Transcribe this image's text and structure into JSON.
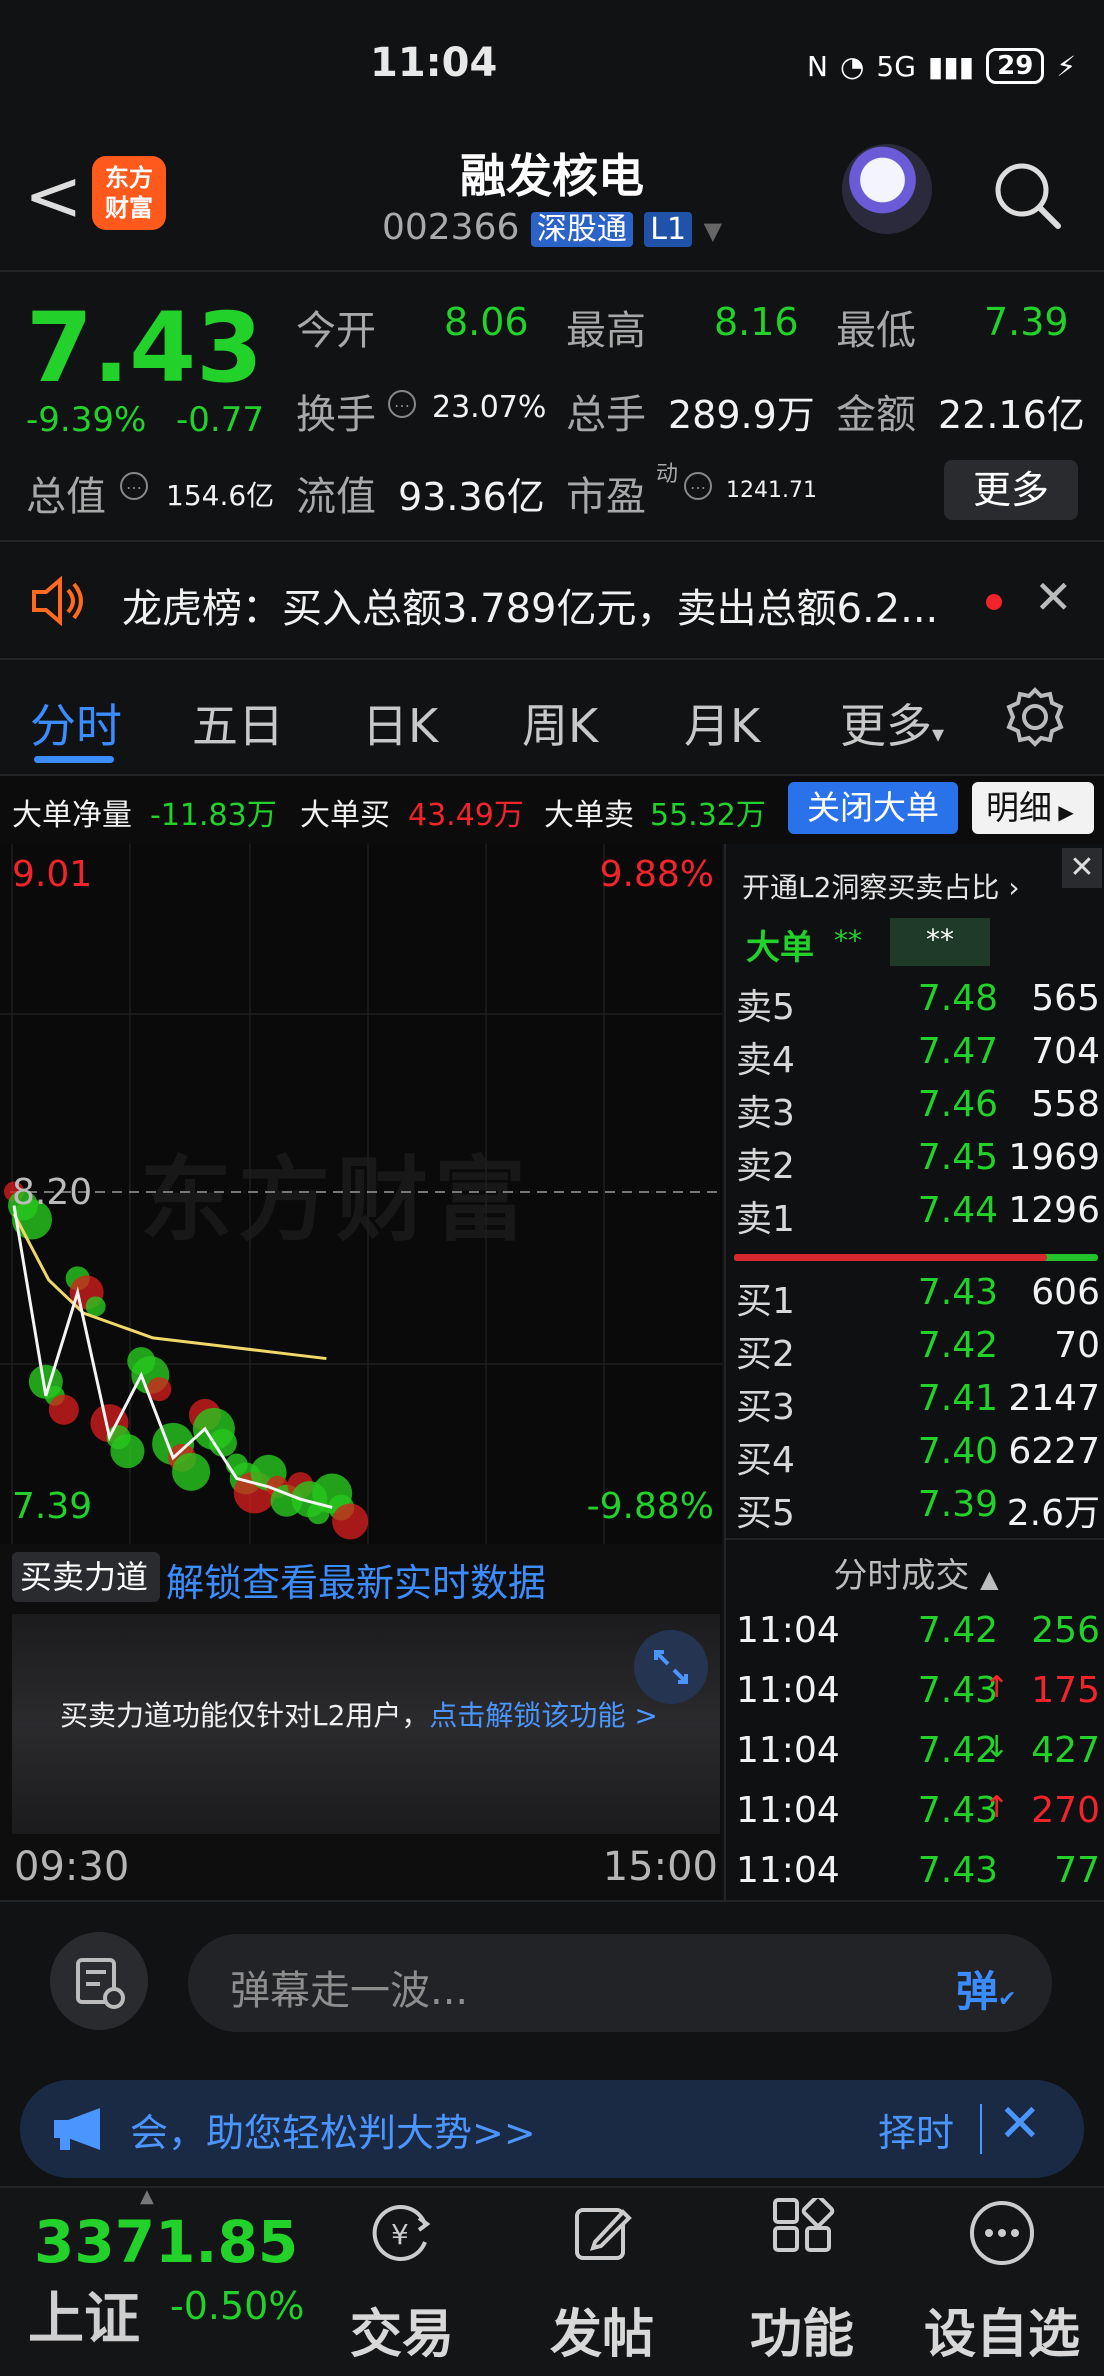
{
  "status": {
    "time": "11:04",
    "network": "5G",
    "battery": "29"
  },
  "header": {
    "back_label": "<",
    "logo_text_1": "东方",
    "logo_text_2": "财富",
    "stock_name": "融发核电",
    "stock_code": "002366",
    "tag_connect": "深股通",
    "tag_level": "L1"
  },
  "quote": {
    "price": "7.43",
    "pct_change": "-9.39%",
    "change": "-0.77",
    "open_label": "今开",
    "open": "8.06",
    "high_label": "最高",
    "high": "8.16",
    "low_label": "最低",
    "low": "7.39",
    "turnover_label": "换手",
    "turnover": "23.07%",
    "volume_label": "总手",
    "volume": "289.9万",
    "amount_label": "金额",
    "amount": "22.16亿",
    "mktcap_label": "总值",
    "mktcap": "154.6亿",
    "float_label": "流值",
    "float_cap": "93.36亿",
    "pe_label": "市盈",
    "pe_sup": "动",
    "pe": "1241.71",
    "more_label": "更多"
  },
  "news": {
    "text": "龙虎榜：买入总额3.789亿元，卖出总额6.2..."
  },
  "tabs": [
    "分时",
    "五日",
    "日K",
    "周K",
    "月K",
    "更多"
  ],
  "big_order": {
    "net_label": "大单净量",
    "net": "-11.83万",
    "buy_label": "大单买",
    "buy": "43.49万",
    "sell_label": "大单卖",
    "sell": "55.32万",
    "close_label": "关闭大单",
    "detail_label": "明细"
  },
  "chart": {
    "top_left": "9.01",
    "top_right": "9.88%",
    "mid_left": "8.20",
    "bottom_left": "7.39",
    "bottom_right": "-9.88%",
    "watermark": "东方财富"
  },
  "chart_data": {
    "type": "line",
    "title": "",
    "xlabel": "",
    "ylabel": "",
    "x_range": [
      "09:30",
      "15:00"
    ],
    "ylim": [
      7.39,
      9.01
    ],
    "reference_price": 8.2,
    "series": [
      {
        "name": "",
        "values": [
          8.14,
          7.98,
          7.9,
          7.87,
          7.84,
          7.83,
          7.82,
          7.81,
          7.8,
          7.79
        ]
      },
      {
        "name": "",
        "values": [
          8.16,
          7.7,
          7.95,
          7.6,
          7.75,
          7.55,
          7.62,
          7.5,
          7.48,
          7.45,
          7.43
        ]
      }
    ]
  },
  "book": {
    "promo": "开通L2洞察买卖占比",
    "big_label": "大单",
    "big_val1": "**",
    "big_val2": "**",
    "sells": [
      {
        "name": "卖5",
        "price": "7.48",
        "vol": "565"
      },
      {
        "name": "卖4",
        "price": "7.47",
        "vol": "704"
      },
      {
        "name": "卖3",
        "price": "7.46",
        "vol": "558"
      },
      {
        "name": "卖2",
        "price": "7.45",
        "vol": "1969"
      },
      {
        "name": "卖1",
        "price": "7.44",
        "vol": "1296"
      }
    ],
    "buy_ratio": 0.86,
    "buys": [
      {
        "name": "买1",
        "price": "7.43",
        "vol": "606"
      },
      {
        "name": "买2",
        "price": "7.42",
        "vol": "70"
      },
      {
        "name": "买3",
        "price": "7.41",
        "vol": "2147"
      },
      {
        "name": "买4",
        "price": "7.40",
        "vol": "6227"
      },
      {
        "name": "买5",
        "price": "7.39",
        "vol": "2.6万"
      }
    ],
    "trades_title": "分时成交",
    "trades": [
      {
        "time": "11:04",
        "price": "7.42",
        "arrow": "",
        "vol": "256",
        "dir": "sell"
      },
      {
        "time": "11:04",
        "price": "7.43",
        "arrow": "↑",
        "vol": "175",
        "dir": "buy"
      },
      {
        "time": "11:04",
        "price": "7.42",
        "arrow": "↓",
        "vol": "427",
        "dir": "sell"
      },
      {
        "time": "11:04",
        "price": "7.43",
        "arrow": "↑",
        "vol": "270",
        "dir": "buy"
      },
      {
        "time": "11:04",
        "price": "7.43",
        "arrow": "",
        "vol": "77",
        "dir": "sell"
      }
    ]
  },
  "lower": {
    "selector_label": "买卖力道",
    "unlock_link": "解锁查看最新实时数据",
    "lock_text": "买卖力道功能仅针对L2用户，",
    "lock_link": "点击解锁该功能 >",
    "time_start": "09:30",
    "time_end": "15:00"
  },
  "danmaku": {
    "placeholder": "弹幕走一波...",
    "send_label": "弹"
  },
  "promo": {
    "text": "会，助您轻松判大势>>",
    "button": "择时"
  },
  "nav": {
    "index_value": "3371.85",
    "index_name": "上证",
    "index_pct": "-0.50%",
    "items": [
      "交易",
      "发帖",
      "功能",
      "设自选"
    ]
  },
  "colors": {
    "up": "#f0242a",
    "down": "#22d12a",
    "accent": "#3b8cff"
  }
}
